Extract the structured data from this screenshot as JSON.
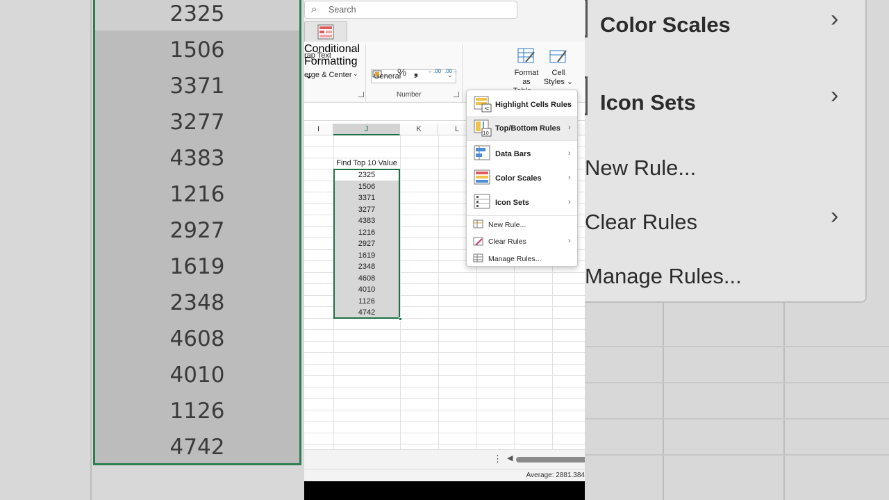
{
  "titlebar": {
    "search_placeholder": "Search"
  },
  "ribbon": {
    "wrap_text": "rap Text",
    "merge_center": "erge & Center",
    "number_format": "General",
    "number_group_label": "Number",
    "percent_symbol": "%",
    "comma_symbol": "❟",
    "inc_decimal": ".00",
    "dec_decimal": ".00",
    "conditional_formatting": [
      "Conditional",
      "Formatting"
    ],
    "format_as_table": [
      "Format as",
      "Table"
    ],
    "cell_styles": [
      "Cell",
      "Styles"
    ]
  },
  "grid": {
    "columns": [
      "I",
      "J",
      "K",
      "L"
    ],
    "header_cell": "Find Top 10 Value",
    "values": [
      "2325",
      "1506",
      "3371",
      "3277",
      "4383",
      "1216",
      "2927",
      "1619",
      "2348",
      "4608",
      "4010",
      "1126",
      "4742"
    ]
  },
  "status": {
    "average": "Average: 2881.384"
  },
  "cf_menu": {
    "items": [
      {
        "label": "Highlight Cells Rules",
        "submenu": true
      },
      {
        "label": "Top/Bottom Rules",
        "submenu": true
      },
      {
        "label": "Data Bars",
        "submenu": true
      },
      {
        "label": "Color Scales",
        "submenu": true
      },
      {
        "label": "Icon Sets",
        "submenu": true
      },
      {
        "label": "New Rule...",
        "submenu": false
      },
      {
        "label": "Clear Rules",
        "submenu": true
      },
      {
        "label": "Manage Rules...",
        "submenu": false
      }
    ]
  },
  "background_zoom": {
    "values": [
      "2325",
      "1506",
      "3371",
      "3277",
      "4383",
      "1216",
      "2927",
      "1619",
      "2348",
      "4608",
      "4010",
      "1126",
      "4742"
    ],
    "menu_items": [
      "Color Scales",
      "Icon Sets",
      "New Rule...",
      "Clear Rules",
      "Manage Rules..."
    ]
  },
  "colors": {
    "accent_green": "#1e7145",
    "selection_fill": "#d7d7d7"
  }
}
